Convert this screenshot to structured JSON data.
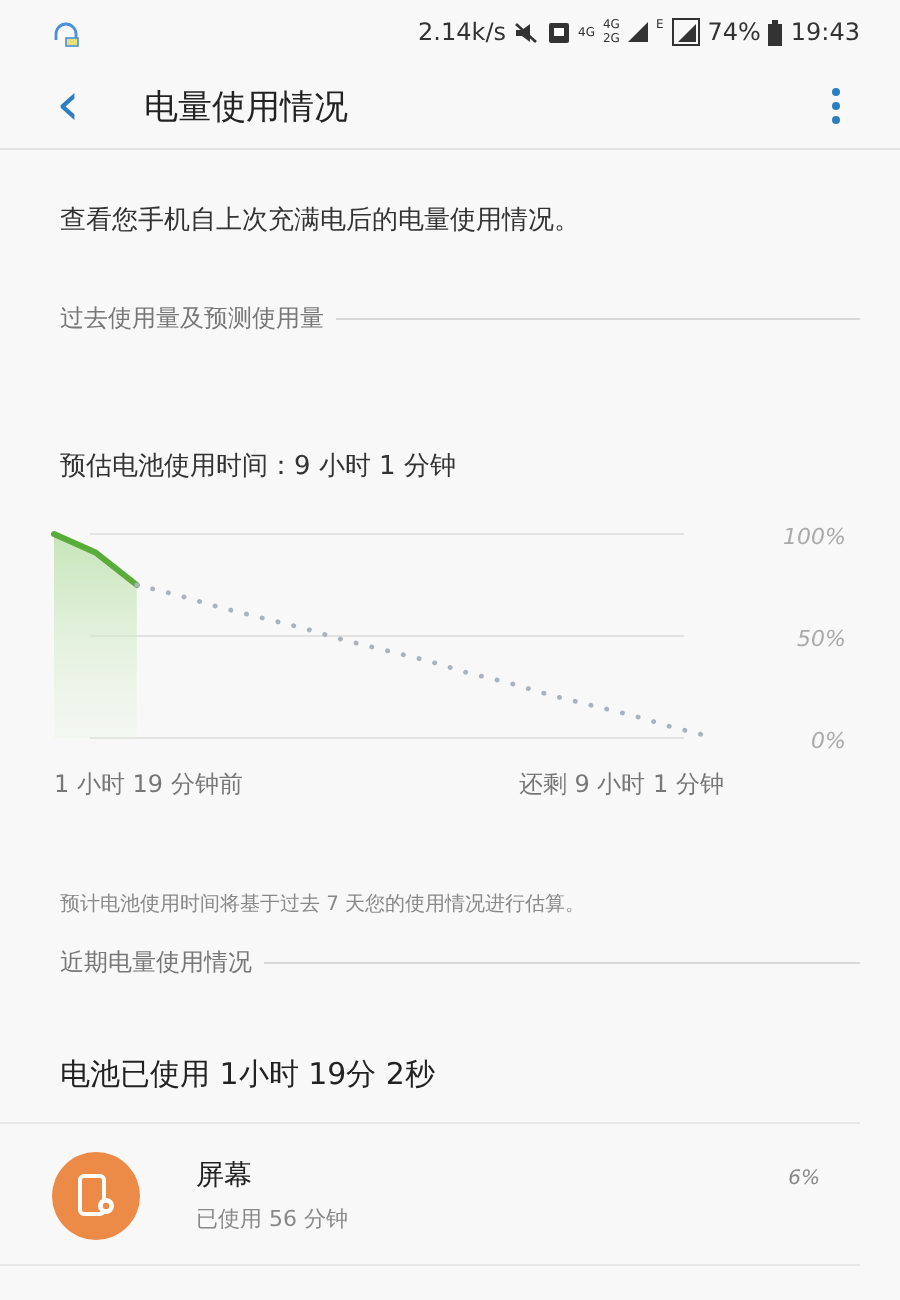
{
  "status_bar": {
    "speed": "2.14k/s",
    "network_1": "4G",
    "network_2": "4G",
    "network_3": "2G",
    "network_4": "E",
    "battery": "74%",
    "time": "19:43"
  },
  "header": {
    "back": "‹",
    "title": "电量使用情况"
  },
  "description": "查看您手机自上次充满电后的电量使用情况。",
  "past_section": {
    "title": "过去使用量及预测使用量",
    "estimate": "预估电池使用时间：9 小时 1 分钟",
    "chart_data": {
      "type": "line",
      "categories": [
        null,
        null,
        null,
        null,
        null,
        null,
        null,
        null,
        null,
        null,
        null,
        null,
        null,
        null,
        null,
        null,
        null
      ],
      "series": [
        {
          "color": "#5aac3a",
          "line_style": "solid",
          "values": [
            100,
            91,
            75,
            null,
            null,
            null,
            null,
            null,
            null,
            null,
            null,
            null,
            null,
            null,
            null,
            null,
            null
          ]
        },
        {
          "color": "#aab2bc",
          "line_style": "dotted",
          "values": [
            null,
            null,
            75,
            70,
            64,
            59,
            54,
            48,
            43,
            38,
            32,
            27,
            21,
            16,
            11,
            5,
            0
          ]
        }
      ],
      "ylim": [
        0,
        100
      ],
      "yticks": [
        {
          "value": 100,
          "label": "100%"
        },
        {
          "value": 50,
          "label": "50%"
        },
        {
          "value": 0,
          "label": "0%"
        }
      ]
    },
    "start_label": "1 小时 19 分钟前",
    "end_label": "还剩 9 小时 1 分钟",
    "note": "预计电池使用时间将基于过去 7 天您的使用情况进行估算。"
  },
  "recent_section": {
    "title": "近期电量使用情况",
    "total": "电池已使用 1小时 19分 2秒",
    "items": [
      {
        "name": "屏幕",
        "usage": "已使用 56 分钟",
        "percent": "6%",
        "color": "#ec8a48"
      }
    ]
  }
}
